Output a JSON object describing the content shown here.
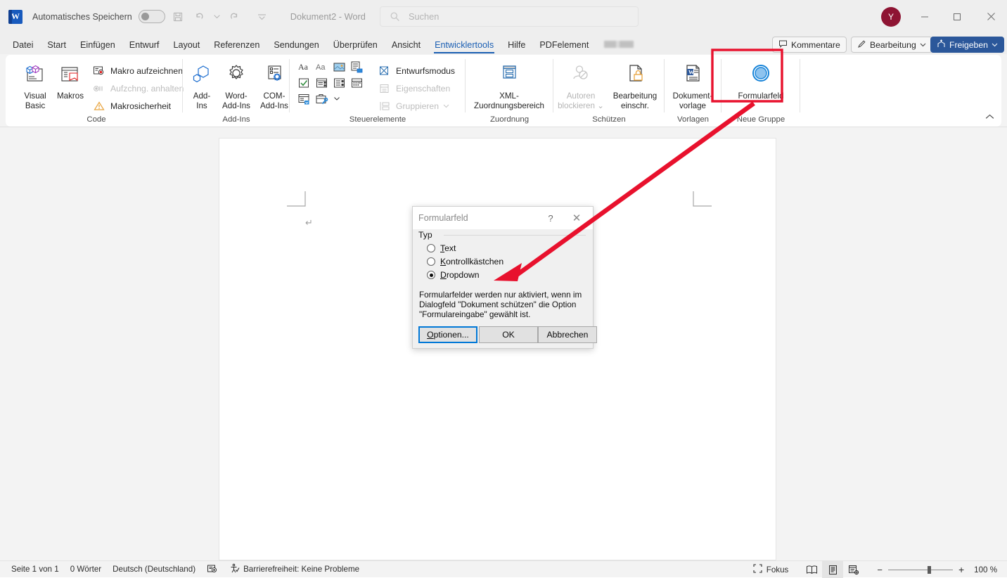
{
  "titlebar": {
    "app_icon": "word-logo",
    "autosave_label": "Automatisches Speichern",
    "autosave_state": "off",
    "qat": [
      {
        "name": "save-button",
        "icon": "save-icon"
      },
      {
        "name": "undo-button",
        "icon": "undo-icon"
      },
      {
        "name": "redo-button",
        "icon": "redo-icon"
      },
      {
        "name": "customize-qat-button",
        "icon": "chevron-down-icon"
      }
    ],
    "document_title": "Dokument2  -  Word",
    "avatar_initial": "Y",
    "window_controls": {
      "minimize": "—",
      "maximize": "□",
      "close": "✕"
    }
  },
  "search": {
    "placeholder": "Suchen",
    "icon": "search-icon"
  },
  "tabs": [
    {
      "label": "Datei",
      "active": false
    },
    {
      "label": "Start",
      "active": false
    },
    {
      "label": "Einfügen",
      "active": false
    },
    {
      "label": "Entwurf",
      "active": false
    },
    {
      "label": "Layout",
      "active": false
    },
    {
      "label": "Referenzen",
      "active": false
    },
    {
      "label": "Sendungen",
      "active": false
    },
    {
      "label": "Überprüfen",
      "active": false
    },
    {
      "label": "Ansicht",
      "active": false
    },
    {
      "label": "Entwicklertools",
      "active": true
    },
    {
      "label": "Hilfe",
      "active": false
    },
    {
      "label": "PDFelement",
      "active": false
    }
  ],
  "tab_chips": {
    "comments": "Kommentare",
    "editing": "Bearbeitung",
    "share": "Freigeben"
  },
  "ribbon": {
    "collapse_icon": "chevron-up-icon",
    "groups": [
      {
        "name": "code",
        "label": "Code",
        "big_buttons": [
          {
            "label": "Visual\nBasic",
            "label_l1": "Visual",
            "label_l2": "Basic",
            "icon": "visual-basic-icon",
            "disabled": false
          },
          {
            "label": "Makros",
            "label_l1": "Makros",
            "label_l2": "",
            "icon": "macros-icon",
            "disabled": false
          }
        ],
        "small_buttons": [
          {
            "label": "Makro aufzeichnen",
            "icon": "record-macro-icon",
            "disabled": false
          },
          {
            "label": "Aufzchng. anhalten",
            "icon": "pause-recording-icon",
            "disabled": true
          },
          {
            "label": "Makrosicherheit",
            "icon": "macro-security-icon",
            "disabled": false
          }
        ]
      },
      {
        "name": "add-ins",
        "label": "Add-Ins",
        "big_buttons": [
          {
            "label_l1": "Add-",
            "label_l2": "Ins",
            "icon": "add-ins-icon",
            "disabled": false
          },
          {
            "label_l1": "Word-",
            "label_l2": "Add-Ins",
            "icon": "word-add-ins-icon",
            "disabled": false
          },
          {
            "label_l1": "COM-",
            "label_l2": "Add-Ins",
            "icon": "com-add-ins-icon",
            "disabled": false
          }
        ]
      },
      {
        "name": "steuerelemente",
        "label": "Steuerelemente",
        "grid_icons": [
          "rich-text-content-control-icon",
          "plain-text-content-control-icon",
          "picture-content-control-icon",
          "building-block-gallery-icon",
          "checkbox-content-control-icon",
          "combo-box-content-control-icon",
          "dropdown-list-content-control-icon",
          "date-picker-content-control-icon",
          "repeating-section-content-control-icon",
          "legacy-tools-icon"
        ],
        "small_buttons": [
          {
            "label": "Entwurfsmodus",
            "icon": "design-mode-icon",
            "disabled": false
          },
          {
            "label": "Eigenschaften",
            "icon": "properties-icon",
            "disabled": true
          },
          {
            "label": "Gruppieren",
            "icon": "group-icon",
            "disabled": true,
            "caret": true
          }
        ]
      },
      {
        "name": "zuordnung",
        "label": "Zuordnung",
        "big_buttons": [
          {
            "label_l1": "XML-",
            "label_l2": "Zuordnungsbereich",
            "icon": "xml-mapping-pane-icon",
            "disabled": false
          }
        ]
      },
      {
        "name": "schuetzen",
        "label": "Schützen",
        "big_buttons": [
          {
            "label_l1": "Autoren",
            "label_l2": "blockieren",
            "icon": "block-authors-icon",
            "disabled": true,
            "caret": true
          },
          {
            "label_l1": "Bearbeitung",
            "label_l2": "einschr.",
            "icon": "restrict-editing-icon",
            "disabled": false
          }
        ]
      },
      {
        "name": "vorlagen",
        "label": "Vorlagen",
        "big_buttons": [
          {
            "label_l1": "Dokument-",
            "label_l2": "vorlage",
            "icon": "document-template-icon",
            "disabled": false
          }
        ]
      },
      {
        "name": "neue-gruppe",
        "label": "Neue Gruppe",
        "big_buttons": [
          {
            "label_l1": "Formularfeld",
            "label_l2": "",
            "icon": "form-field-icon",
            "disabled": false,
            "highlighted": true
          }
        ]
      }
    ]
  },
  "document": {
    "pilcrow": "↵"
  },
  "dialog": {
    "title": "Formularfeld",
    "help_glyph": "?",
    "close_glyph": "✕",
    "group_label": "Typ",
    "options": [
      {
        "label": "Text",
        "mnemonic": "T",
        "rest": "ext",
        "selected": false
      },
      {
        "label": "Kontrollkästchen",
        "mnemonic": "K",
        "rest": "ontrollkästchen",
        "selected": false
      },
      {
        "label": "Dropdown",
        "mnemonic": "D",
        "rest": "ropdown",
        "selected": true
      }
    ],
    "note": "Formularfelder werden nur aktiviert, wenn im Dialogfeld \"Dokument schützen\" die Option \"Formulareingabe\" gewählt ist.",
    "buttons": [
      {
        "name": "options-button",
        "label": "Optionen...",
        "mnemonic": "O",
        "rest": "ptionen...",
        "focused": true
      },
      {
        "name": "ok-button",
        "label": "OK",
        "mnemonic": "",
        "rest": "OK",
        "focused": false
      },
      {
        "name": "cancel-button",
        "label": "Abbrechen",
        "mnemonic": "",
        "rest": "Abbrechen",
        "focused": false
      }
    ]
  },
  "annotation": {
    "highlight_color": "#E8112D",
    "arrow_color": "#E8112D",
    "description": "red-rectangle-around-formularfeld-with-arrow-to-dropdown-option"
  },
  "statusbar": {
    "page": "Seite 1 von 1",
    "words": "0 Wörter",
    "language": "Deutsch (Deutschland)",
    "proofing_icon": "proofing-status-icon",
    "accessibility": "Barrierefreiheit: Keine Probleme",
    "accessibility_icon": "accessibility-icon",
    "focus": "Fokus",
    "focus_icon": "focus-mode-icon",
    "views": [
      {
        "name": "read-mode-button",
        "icon": "read-mode-icon",
        "active": false
      },
      {
        "name": "print-layout-button",
        "icon": "print-layout-icon",
        "active": true
      },
      {
        "name": "web-layout-button",
        "icon": "web-layout-icon",
        "active": false
      }
    ],
    "zoom_out": "−",
    "zoom_in": "+",
    "zoom_level": "100 %"
  }
}
